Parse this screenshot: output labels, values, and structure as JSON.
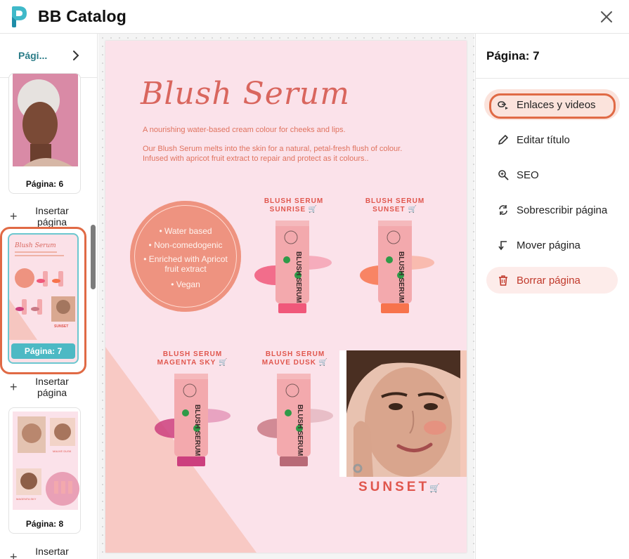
{
  "header": {
    "app_title": "BB Catalog",
    "close_icon": "close-icon"
  },
  "left_panel": {
    "pages_label": "Pági...",
    "pages": [
      {
        "label": "Página: 6"
      },
      {
        "label": "Página: 7",
        "selected": true
      },
      {
        "label": "Página: 8"
      }
    ],
    "insert_label": "Insertar página"
  },
  "catalog_page": {
    "title": "Blush Serum",
    "tagline": "A nourishing water-based cream colour for cheeks and lips.",
    "description": "Our Blush Serum melts into the skin for a natural, petal-fresh flush of colour. Infused with apricot fruit extract to repair and protect as it colours..",
    "features": [
      "• Water based",
      "• Non-comedogenic",
      "• Enriched with Apricot fruit extract",
      "• Vegan"
    ],
    "products": [
      {
        "line1": "BLUSH SERUM",
        "line2": "SUNRISE",
        "color": "#f0587a"
      },
      {
        "line1": "BLUSH SERUM",
        "line2": "SUNSET",
        "color": "#f7734c"
      },
      {
        "line1": "BLUSH SERUM",
        "line2": "MAGENTA SKY",
        "color": "#cc3f7e"
      },
      {
        "line1": "BLUSH SERUM",
        "line2": "MAUVE DUSK",
        "color": "#c97a86"
      }
    ],
    "tube_brand": "BLUSH SERUM",
    "banner_word": "SUNSET",
    "cart_icon": "cart-icon"
  },
  "right_panel": {
    "title": "Página: 7",
    "menu": [
      {
        "label": "Enlaces y videos",
        "icon": "link-video-icon"
      },
      {
        "label": "Editar título",
        "icon": "pencil-icon"
      },
      {
        "label": "SEO",
        "icon": "search-zoom-icon"
      },
      {
        "label": "Sobrescribir página",
        "icon": "refresh-icon"
      },
      {
        "label": "Mover página",
        "icon": "move-arrow-icon"
      },
      {
        "label": "Borrar página",
        "icon": "trash-icon"
      }
    ]
  },
  "colors": {
    "accent_teal": "#4cb9c4",
    "highlight_orange": "#e06a45",
    "page_pink": "#fbe2ea",
    "brand_coral": "#e0564d"
  }
}
